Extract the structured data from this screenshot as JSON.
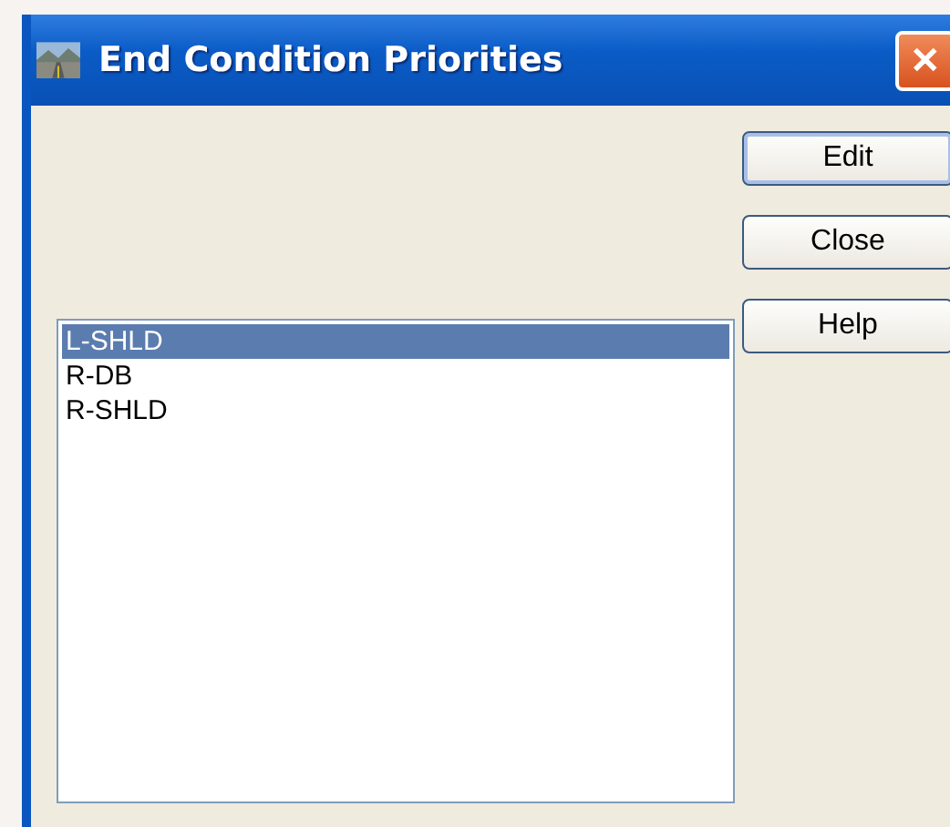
{
  "window": {
    "title": "End Condition Priorities",
    "close_glyph": "✕"
  },
  "list": {
    "items": [
      {
        "label": "L-SHLD",
        "selected": true
      },
      {
        "label": "R-DB",
        "selected": false
      },
      {
        "label": "R-SHLD",
        "selected": false
      }
    ]
  },
  "buttons": [
    {
      "label": "Edit",
      "default": true
    },
    {
      "label": "Close",
      "default": false
    },
    {
      "label": "Help",
      "default": false
    }
  ]
}
